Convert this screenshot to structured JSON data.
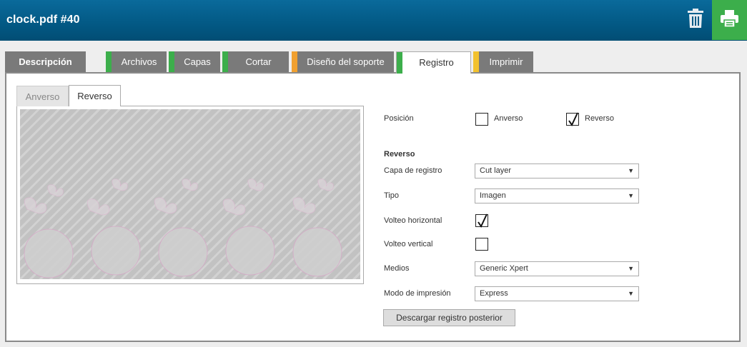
{
  "header": {
    "title": "clock.pdf #40",
    "delete_icon": "trash-icon",
    "print_icon": "printer-icon",
    "print_color": "#3cae4b"
  },
  "tabs": [
    {
      "label": "Descripción",
      "status": null
    },
    {
      "label": "Archivos",
      "status": "#3cae4b"
    },
    {
      "label": "Capas",
      "status": "#3cae4b"
    },
    {
      "label": "Cortar",
      "status": "#3cae4b"
    },
    {
      "label": "Diseño del soporte",
      "status": "#f0a030"
    },
    {
      "label": "Registro",
      "status": "#3cae4b",
      "active": true
    },
    {
      "label": "Imprimir",
      "status": "#f2c12e"
    }
  ],
  "subtabs": [
    {
      "label": "Anverso",
      "active": false
    },
    {
      "label": "Reverso",
      "active": true
    }
  ],
  "form": {
    "position_label": "Posición",
    "position_front": {
      "label": "Anverso",
      "checked": false
    },
    "position_back": {
      "label": "Reverso",
      "checked": true
    },
    "section_title": "Reverso",
    "layer_label": "Capa de registro",
    "layer_value": "Cut layer",
    "type_label": "Tipo",
    "type_value": "Imagen",
    "hflip_label": "Volteo horizontal",
    "hflip_checked": true,
    "vflip_label": "Volteo vertical",
    "vflip_checked": false,
    "media_label": "Medios",
    "media_value": "Generic Xpert",
    "mode_label": "Modo de impresión",
    "mode_value": "Express",
    "download_label": "Descargar registro posterior"
  }
}
